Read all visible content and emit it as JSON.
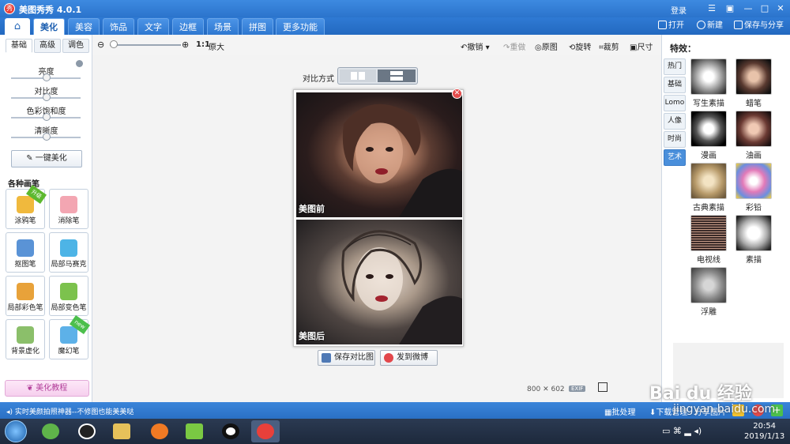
{
  "app": {
    "title": "美图秀秀 4.0.1",
    "logo": "秀",
    "login": "登录"
  },
  "window_controls": {
    "menu": "☰",
    "min": "—",
    "max": "□",
    "close": "✕"
  },
  "nav": {
    "home_icon": "home-icon",
    "tabs": [
      "美化",
      "美容",
      "饰品",
      "文字",
      "边框",
      "场景",
      "拼图",
      "更多功能 ▾"
    ],
    "active_tab": "美化",
    "open": "打开",
    "new": "新建",
    "save_share": "保存与分享"
  },
  "toolbar": {
    "ratio": "1:1",
    "original_size": "原大",
    "undo": "撤销",
    "redo": "重做",
    "original": "原图",
    "rotate": "旋转",
    "crop": "裁剪",
    "size": "尺寸"
  },
  "left": {
    "subtabs": [
      "基础",
      "高级",
      "调色"
    ],
    "sliders": [
      {
        "label": "亮度",
        "value": 0.5
      },
      {
        "label": "对比度",
        "value": 0.5
      },
      {
        "label": "色彩饱和度",
        "value": 0.5
      },
      {
        "label": "清晰度",
        "value": 0.5
      }
    ],
    "one_key": "一键美化",
    "brush_title": "各种画笔",
    "brushes": [
      {
        "label": "涂鸦笔",
        "badge": "升级",
        "color": "#f0b93d"
      },
      {
        "label": "消除笔",
        "badge": "",
        "color": "#f3a6b2"
      },
      {
        "label": "抠图笔",
        "badge": "",
        "color": "#5a93d6"
      },
      {
        "label": "局部马赛克",
        "badge": "",
        "color": "#4db4e6"
      },
      {
        "label": "局部彩色笔",
        "badge": "",
        "color": "#e8a23a"
      },
      {
        "label": "局部变色笔",
        "badge": "",
        "color": "#7cc24d"
      },
      {
        "label": "背景虚化",
        "badge": "",
        "color": "#8bbf6a"
      },
      {
        "label": "魔幻笔",
        "badge": "new",
        "color": "#5db1e8"
      }
    ],
    "tutorial": "美化教程"
  },
  "canvas": {
    "compare_label": "对比方式",
    "before": "美图前",
    "after": "美图后",
    "save_compare": "保存对比图",
    "send_weibo": "发到微博",
    "dims_w": "800",
    "dims_x": "✕",
    "dims_h": "602",
    "exif": "EXIF"
  },
  "right": {
    "title": "特效：",
    "tabs": [
      "热门",
      "基础",
      "Lomo",
      "人像",
      "时尚",
      "艺术"
    ],
    "active_tab": "艺术",
    "effects": [
      "写生素描",
      "蜡笔",
      "漫画",
      "油画",
      "古典素描",
      "彩铅",
      "电视线",
      "素描",
      "浮雕"
    ]
  },
  "status": {
    "text": "实时美颜拍照神器--不修图也能美美哒",
    "batch": "批处理",
    "download": "下载管理",
    "share": "分享图片"
  },
  "taskbar": {
    "time": "20:54",
    "date": "2019/1/13"
  },
  "watermark": {
    "text": "Bai du 经验",
    "url": "jingyan.baidu.com"
  },
  "colors": {
    "accent": "#2b74cc",
    "active_tab_text": "#1d5fb0"
  }
}
